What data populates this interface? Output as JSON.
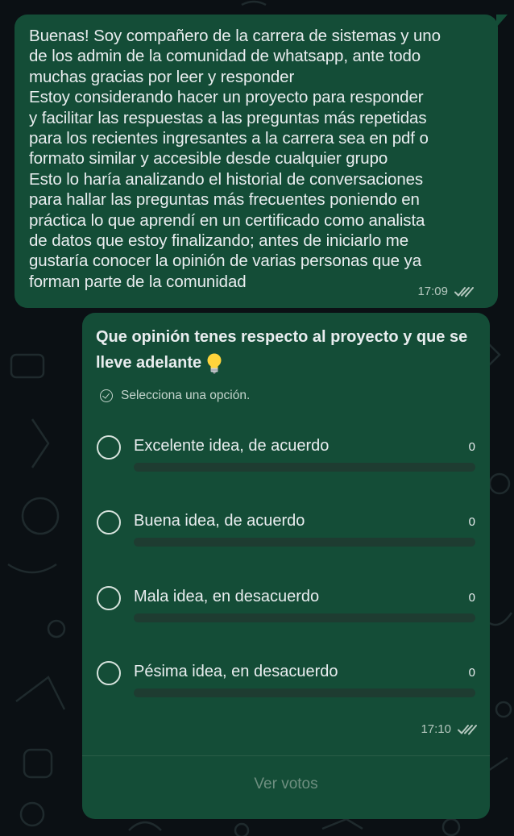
{
  "message": {
    "text": "Buenas! Soy compañero de la carrera de sistemas y uno\nde los admin de la comunidad de whatsapp, ante todo\nmuchas gracias por leer y responder\nEstoy considerando hacer un proyecto para responder\ny facilitar las respuestas a las preguntas más repetidas\npara los recientes ingresantes a la carrera sea en pdf o\nformato similar y accesible desde cualquier grupo\nEsto lo haría analizando el historial de conversaciones\npara hallar las preguntas más frecuentes poniendo en\npráctica lo que aprendí en un certificado como analista\nde datos que estoy finalizando; antes de iniciarlo me\ngustaría conocer la opinión de varias personas que ya\nforman parte de la comunidad",
    "time": "17:09",
    "status_icon": "double-check-read-icon"
  },
  "poll": {
    "question": "Que opinión tenes respecto al proyecto y que se lleve adelante",
    "question_emoji": "light-bulb-icon",
    "hint": "Selecciona una opción.",
    "options": [
      {
        "label": "Excelente idea, de acuerdo",
        "count": "0",
        "fraction": 0
      },
      {
        "label": "Buena idea, de acuerdo",
        "count": "0",
        "fraction": 0
      },
      {
        "label": "Mala idea, en desacuerdo",
        "count": "0",
        "fraction": 0
      },
      {
        "label": "Pésima idea, en desacuerdo",
        "count": "0",
        "fraction": 0
      }
    ],
    "time": "17:10",
    "status_icon": "double-check-read-icon",
    "view_votes_label": "Ver votos"
  },
  "colors": {
    "background": "#0b1014",
    "bubble": "#144d37",
    "text": "#e9edef"
  }
}
